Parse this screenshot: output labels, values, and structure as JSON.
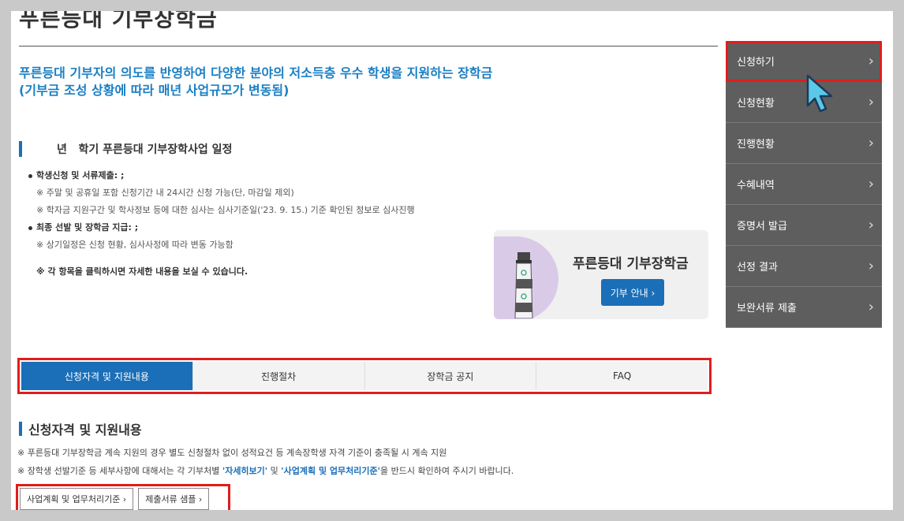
{
  "page": {
    "title": "푸른등대 기부장학금",
    "intro_line1": "푸른등대 기부자의 의도를 반영하여 다양한 분야의 저소득층 우수 학생을 지원하는 장학금",
    "intro_line2": "(기부금 조성 상황에 따라 매년 사업규모가 변동됨)"
  },
  "schedule": {
    "title": "년   학기 푸른등대 기부장학사업 일정",
    "item1_label": "학생신청 및 서류제출: ;",
    "item1_note1": "※ 주말 및 공휴일 포함 신청기간 내 24시간 신청 가능(단, 마감일 제외)",
    "item1_note2": "※ 학자금 지원구간 및 학사정보 등에 대한 심사는 심사기준일('23. 9. 15.) 기준 확인된 정보로 심사진행",
    "item2_label": "최종 선발 및 장학금 지급: ;",
    "item2_note1": "※ 상기일정은 신청 현황, 심사사정에 따라 변동 가능함",
    "click_note": "※ 각 항목을 클릭하시면 자세한 내용을 보실 수 있습니다."
  },
  "card": {
    "title": "푸른등대 기부장학금",
    "button": "기부 안내 ›"
  },
  "sidemenu": [
    {
      "label": "신청하기"
    },
    {
      "label": "신청현황"
    },
    {
      "label": "진행현황"
    },
    {
      "label": "수혜내역"
    },
    {
      "label": "증명서 발급"
    },
    {
      "label": "선정 결과"
    },
    {
      "label": "보완서류 제출"
    }
  ],
  "tabs": [
    {
      "label": "신청자격 및 지원내용"
    },
    {
      "label": "진행절차"
    },
    {
      "label": "장학금 공지"
    },
    {
      "label": "FAQ"
    }
  ],
  "section": {
    "title": "신청자격 및 지원내용",
    "note1": "※ 푸른등대 기부장학금 계속 지원의 경우 별도 신청절차 없이 성적요건 등 계속장학생 자격 기준이 충족될 시 계속 지원",
    "note2_a": "※ 장학생 선발기준 등 세부사항에 대해서는 각 기부처별 ",
    "note2_hl1": "'자세히보기'",
    "note2_b": " 및 ",
    "note2_hl2": "'사업계획 및 업무처리기준'",
    "note2_c": "을 반드시 확인하여 주시기 바랍니다.",
    "btn1": "사업계획 및 업무처리기준 ›",
    "btn2": "제출서류 샘플 ›"
  },
  "icons": {
    "chevron": "chevron-right-icon",
    "cursor": "mouse-pointer-icon",
    "lighthouse": "lighthouse-icon"
  },
  "colors": {
    "accent": "#1a6fb8",
    "highlight_border": "#e01d1d",
    "sidemenu_bg": "#5e5e5e"
  }
}
